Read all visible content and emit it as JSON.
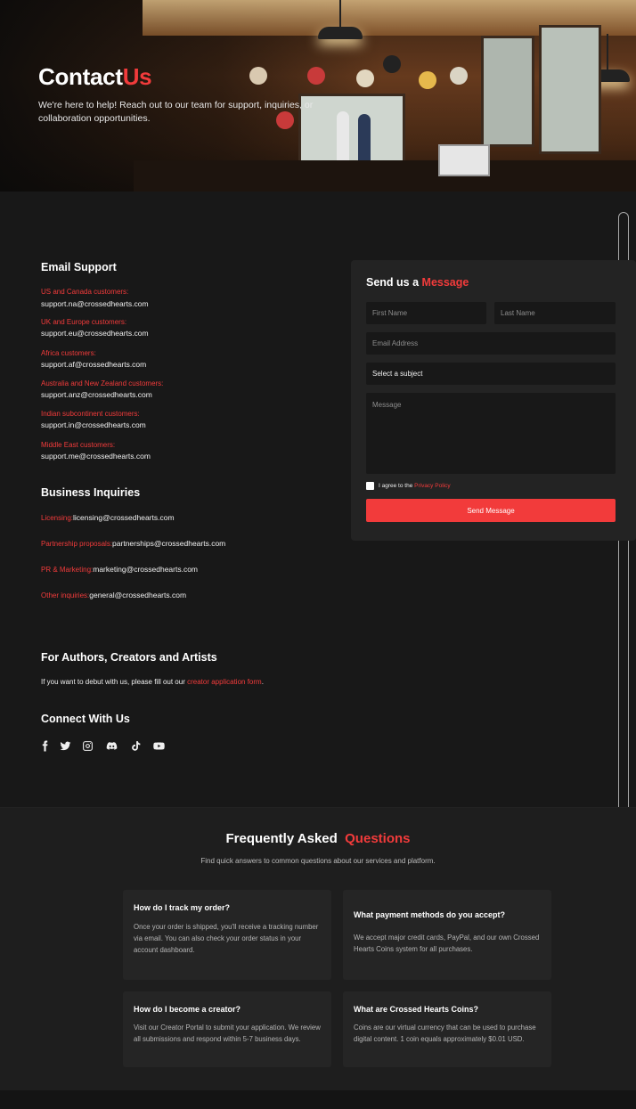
{
  "hero": {
    "title_main": "Contact",
    "title_accent": "Us",
    "subtitle": "We're here to help! Reach out to our team for support, inquiries, or collaboration opportunities."
  },
  "email_support": {
    "title": "Email Support",
    "entries": [
      {
        "region": "US and Canada customers:",
        "email": "support.na@crossedhearts.com"
      },
      {
        "region": "UK and Europe customers:",
        "email": "support.eu@crossedhearts.com"
      },
      {
        "region": "Africa customers:",
        "email": "support.af@crossedhearts.com"
      },
      {
        "region": "Australia and New Zealand customers:",
        "email": "support.anz@crossedhearts.com"
      },
      {
        "region": "Indian subcontinent customers:",
        "email": "support.in@crossedhearts.com"
      },
      {
        "region": "Middle East customers:",
        "email": "support.me@crossedhearts.com"
      }
    ]
  },
  "business": {
    "title": "Business Inquiries",
    "entries": [
      {
        "label": "Licensing:",
        "email": "licensing@crossedhearts.com"
      },
      {
        "label": "Partnership proposals:",
        "email": "partnerships@crossedhearts.com"
      },
      {
        "label": "PR & Marketing:",
        "email": "marketing@crossedhearts.com"
      },
      {
        "label": "Other inquiries:",
        "email": "general@crossedhearts.com"
      }
    ]
  },
  "creators": {
    "title": "For Authors, Creators and Artists",
    "text_before": "If you want to debut with us, please fill out our ",
    "link": "creator application form",
    "text_after": "."
  },
  "connect": {
    "title": "Connect With Us",
    "icons": [
      "facebook-icon",
      "twitter-icon",
      "instagram-icon",
      "discord-icon",
      "tiktok-icon",
      "youtube-icon"
    ]
  },
  "form": {
    "title_main": "Send us a",
    "title_accent": "Message",
    "first_name_placeholder": "First Name",
    "last_name_placeholder": "Last Name",
    "email_placeholder": "Email Address",
    "subject_value": "Select a subject",
    "message_placeholder": "Message",
    "agree_text": "I agree to the ",
    "privacy_link": "Privacy Policy",
    "submit_label": "Send Message"
  },
  "faq": {
    "title_main": "Frequently Asked",
    "title_accent": "Questions",
    "subtitle": "Find quick answers to common questions about our services and platform.",
    "items": [
      {
        "q": "How do I track my order?",
        "a": "Once your order is shipped, you'll receive a tracking number via email. You can also check your order status in your account dashboard."
      },
      {
        "q": "What payment methods do you accept?",
        "a": "We accept major credit cards, PayPal, and our own Crossed Hearts Coins system for all purchases."
      },
      {
        "q": "How do I become a creator?",
        "a": "Visit our Creator Portal to submit your application. We review all submissions and respond within 5-7 business days."
      },
      {
        "q": "What are Crossed Hearts Coins?",
        "a": "Coins are our virtual currency that can be used to purchase digital content. 1 coin equals approximately $0.01 USD."
      }
    ]
  },
  "colors": {
    "accent": "#f23b3b",
    "background": "#181818",
    "panel": "#232323"
  }
}
